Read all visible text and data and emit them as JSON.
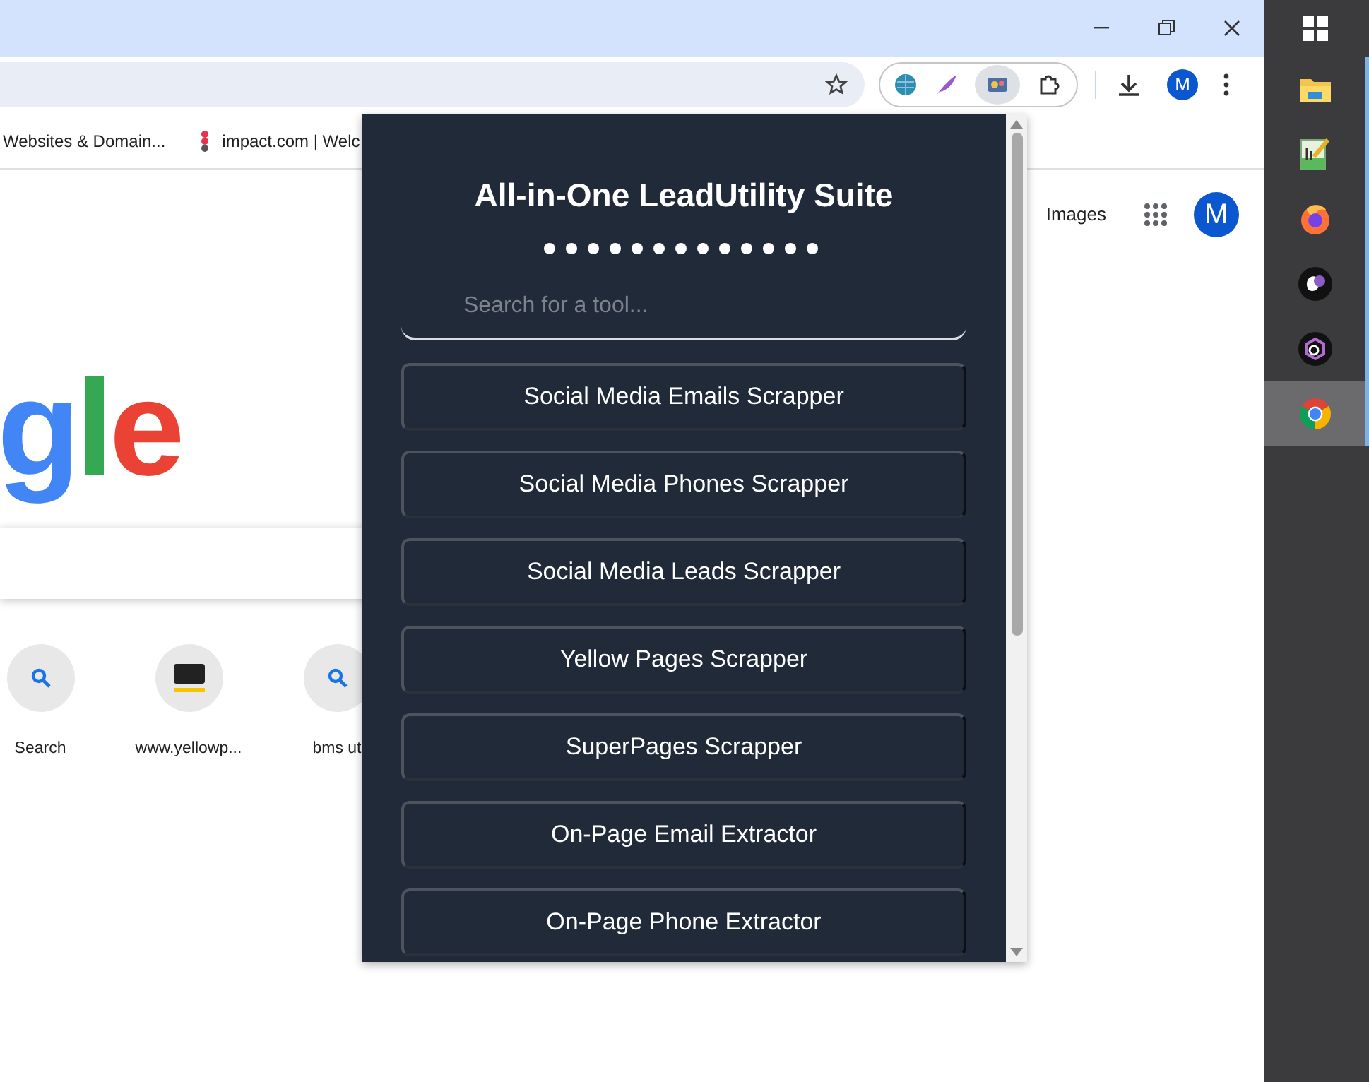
{
  "browser": {
    "profile_initial": "M",
    "bookmarks": [
      {
        "label": "Websites & Domain..."
      },
      {
        "label": "impact.com | Welc"
      }
    ]
  },
  "page": {
    "header_links": [
      {
        "label": "Images"
      }
    ],
    "account_initial": "M",
    "logo_letters": [
      {
        "text": "g",
        "color": "#4285f4"
      },
      {
        "text": "l",
        "color": "#34a853"
      },
      {
        "text": "e",
        "color": "#ea4335"
      }
    ],
    "shortcuts": [
      {
        "label": "Search",
        "kind": "search"
      },
      {
        "label": "www.yellowp...",
        "kind": "yp"
      },
      {
        "label": "bms ut",
        "kind": "search"
      }
    ]
  },
  "popup": {
    "title": "All-in-One LeadUtility Suite",
    "search": {
      "placeholder": "Search for a tool..."
    },
    "tools": [
      {
        "label": "Social Media Emails Scrapper"
      },
      {
        "label": "Social Media Phones Scrapper"
      },
      {
        "label": "Social Media Leads Scrapper"
      },
      {
        "label": "Yellow Pages Scrapper"
      },
      {
        "label": "SuperPages Scrapper"
      },
      {
        "label": "On-Page Email Extractor"
      },
      {
        "label": "On-Page Phone Extractor"
      }
    ]
  },
  "taskbar": {
    "items": [
      {
        "kind": "start",
        "selected": false,
        "running": false
      },
      {
        "kind": "folder",
        "selected": false,
        "running": true
      },
      {
        "kind": "notepad",
        "selected": false,
        "running": true
      },
      {
        "kind": "firefox",
        "selected": false,
        "running": true
      },
      {
        "kind": "round-dark",
        "selected": false,
        "running": true
      },
      {
        "kind": "hex",
        "selected": false,
        "running": true
      },
      {
        "kind": "chrome",
        "selected": true,
        "running": true
      }
    ]
  }
}
